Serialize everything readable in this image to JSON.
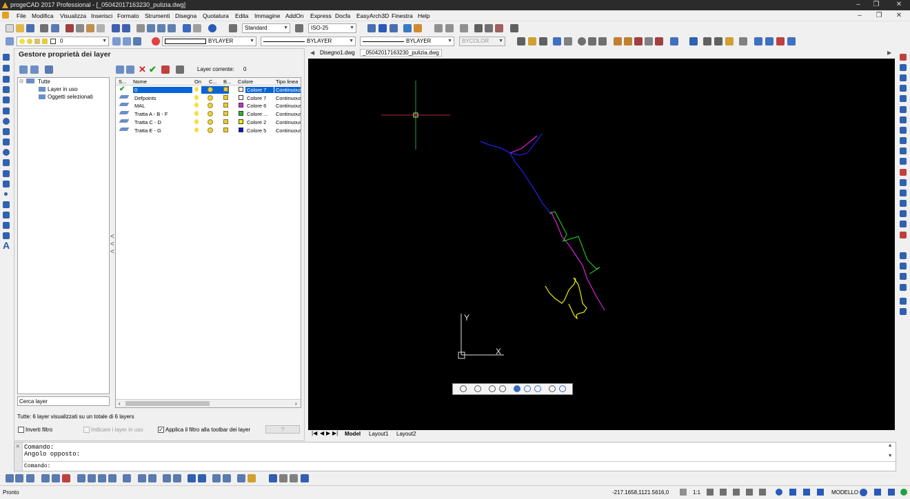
{
  "window": {
    "title": "progeCAD 2017 Professional - [_05042017163230_pulizia.dwg]"
  },
  "menu": [
    "File",
    "Modifica",
    "Visualizza",
    "Inserisci",
    "Formato",
    "Strumenti",
    "Disegna",
    "Quotatura",
    "Edita",
    "Immagine",
    "AddOn",
    "Express",
    "Docfa",
    "EasyArch3D",
    "Finestra",
    "Help"
  ],
  "toolbar": {
    "text_style": "Standard",
    "dim_style": "ISO-25",
    "layer_combo": "0",
    "color": "BYLAYER",
    "linetype": "BYLAYER",
    "lineweight": "BYLAYER",
    "plotstyle": "BYCOLOR"
  },
  "panel": {
    "title": "Gestore proprietà dei layer",
    "current_layer_label": "Layer corrente:",
    "current_layer_value": "0",
    "tree": {
      "root": "Tutte",
      "children": [
        "Layer in uso",
        "Oggetti selezionati"
      ]
    },
    "columns": [
      "S...",
      "Nome",
      "On",
      "C...",
      "B...",
      "Colore",
      "Tipo linea"
    ],
    "layers": [
      {
        "name": "0",
        "color_name": "Colore 7",
        "color": "#ffffff",
        "linetype": "Continuous",
        "current": true,
        "selected": true
      },
      {
        "name": "Defpoints",
        "color_name": "Colore 7",
        "color": "#ffffff",
        "linetype": "Continuous",
        "current": false,
        "selected": false
      },
      {
        "name": "MAL",
        "color_name": "Colore 6",
        "color": "#e020e0",
        "linetype": "Continuous",
        "current": false,
        "selected": false
      },
      {
        "name": "Tratta A - B - F",
        "color_name": "Colore ...",
        "color": "#20c020",
        "linetype": "Continuous",
        "current": false,
        "selected": false
      },
      {
        "name": "Tratta C - D",
        "color_name": "Colore 2",
        "color": "#f0f000",
        "linetype": "Continuous",
        "current": false,
        "selected": false
      },
      {
        "name": "Tratta E - G",
        "color_name": "Colore 5",
        "color": "#1010e0",
        "linetype": "Continuous",
        "current": false,
        "selected": false
      }
    ],
    "search_label": "Cerca layer",
    "status": "Tutte: 6 layer visualizzati su un totale di 6 layers",
    "invert_filter": "Inverti filtro",
    "show_used": "Indicare i layer in uso",
    "apply_filter": "Applica il filtro alla toolbar dei layer",
    "help_btn": "?"
  },
  "doc_tabs": [
    "Disegno1.dwg",
    "_05042017163230_pulizia.dwg"
  ],
  "layout_tabs": [
    "Model",
    "Layout1",
    "Layout2"
  ],
  "ucs": {
    "x": "X",
    "y": "Y"
  },
  "command": {
    "history": [
      "Comando:",
      "Angolo opposto:"
    ],
    "prompt": "Comando:"
  },
  "status": {
    "left": "Pronto",
    "coords": "-217.1658,1121.5616,0",
    "scale": "1:1",
    "mode": "MODELLO"
  }
}
